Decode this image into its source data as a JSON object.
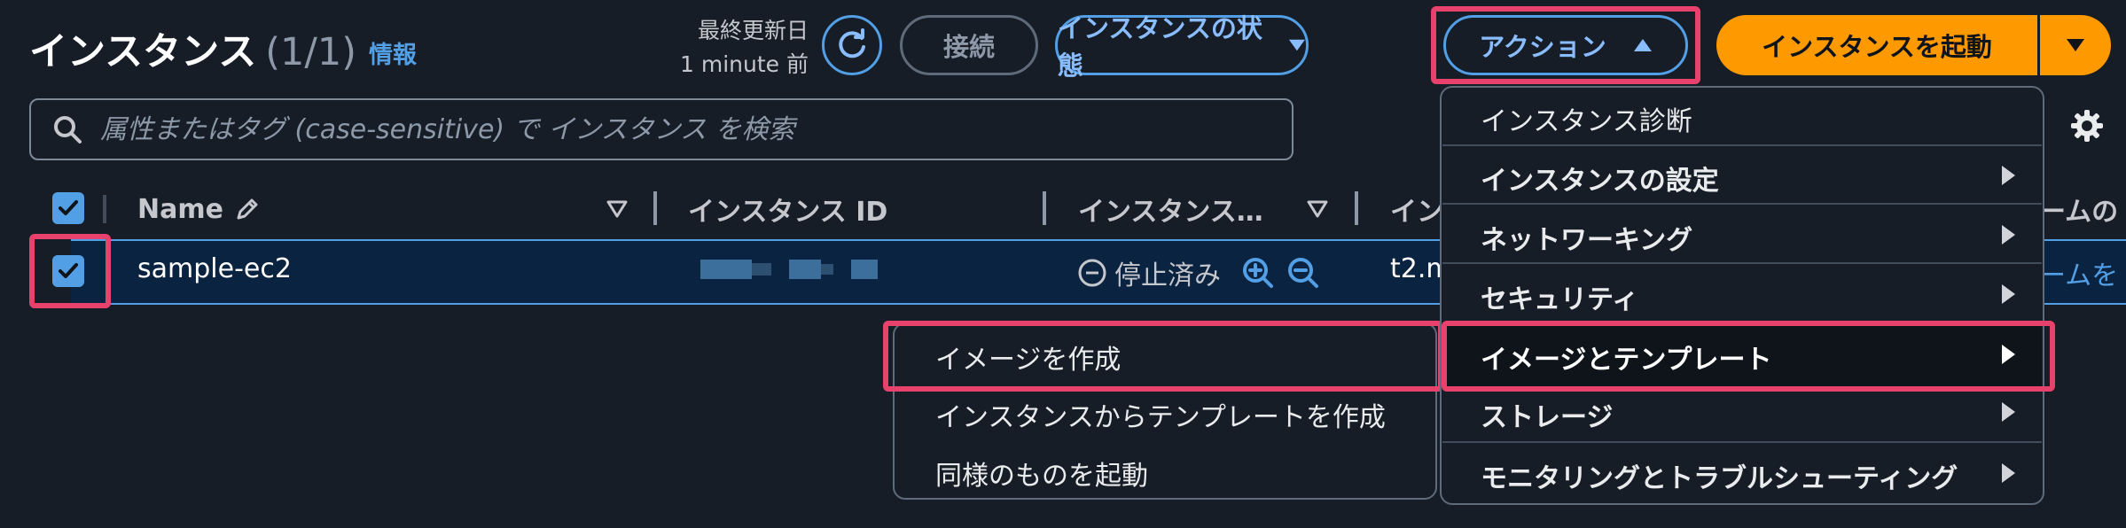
{
  "header": {
    "title": "インスタンス",
    "count": "(1/1)",
    "info_link": "情報",
    "last_updated_label": "最終更新日",
    "last_updated_value": "1 minute 前",
    "connect_label": "接続",
    "state_label": "インスタンスの状態",
    "action_label": "アクション",
    "launch_label": "インスタンスを起動"
  },
  "search": {
    "placeholder": "属性またはタグ (case-sensitive) で インスタンス を検索"
  },
  "table": {
    "columns": [
      "Name",
      "インスタンス ID",
      "インスタンス…",
      "イン",
      "ームの"
    ],
    "rows": [
      {
        "name": "sample-ec2",
        "state": "停止済み",
        "type": "t2.m",
        "cutoff": "ームを"
      }
    ]
  },
  "action_menu": {
    "items": [
      {
        "label": "インスタンス診断",
        "submenu": false
      },
      {
        "label": "インスタンスの設定",
        "submenu": true
      },
      {
        "label": "ネットワーキング",
        "submenu": true
      },
      {
        "label": "セキュリティ",
        "submenu": true
      },
      {
        "label": "イメージとテンプレート",
        "submenu": true
      },
      {
        "label": "ストレージ",
        "submenu": true
      },
      {
        "label": "モニタリングとトラブルシューティング",
        "submenu": true
      }
    ]
  },
  "image_submenu": {
    "items": [
      {
        "label": "イメージを作成"
      },
      {
        "label": "インスタンスからテンプレートを作成"
      },
      {
        "label": "同様のものを起動"
      }
    ]
  },
  "colors": {
    "background": "#161d26",
    "accent_blue": "#539fe5",
    "primary_orange": "#ff9900",
    "highlight_pink": "#e8416b"
  }
}
